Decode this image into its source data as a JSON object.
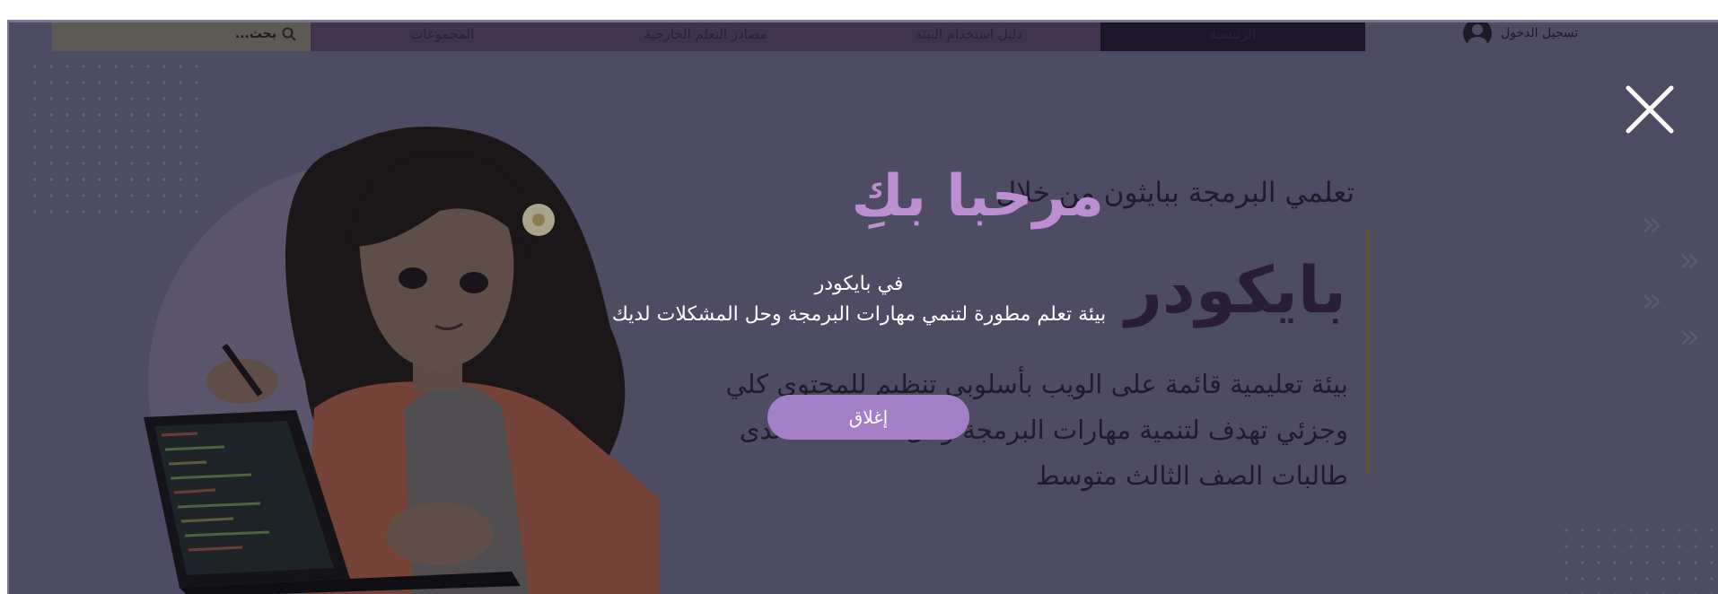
{
  "nav": {
    "search_placeholder": "بحث...",
    "items": [
      "الرئيسية",
      "دليل استخدام البيئة",
      "مصادر التعلم الخارجية",
      "المجموعات"
    ],
    "login_label": "تسجيل الدخول"
  },
  "hero": {
    "lead": "تعلمي البرمجة ببايثون من خلال",
    "brand": "بايكودر",
    "paragraph": "بيئة تعليمية قائمة على الويب بأسلوبي تنظيم للمحتوى كلي وجزئي تهدف لتنمية مهارات البرمجة وحل المشكلات لدى طالبات الصف الثالث متوسط"
  },
  "modal": {
    "title": "مرحبا بكِ",
    "line1": "في بايكودر",
    "line2": "بيئة تعلم مطورة لتنمي مهارات البرمجة وحل المشكلات لديك",
    "close_button": "إغلاق",
    "title_color": "#bb8fd2",
    "button_color": "#a27fc6"
  },
  "icons": {
    "close": "close-icon",
    "search": "search-icon",
    "avatar": "user-avatar-icon"
  }
}
